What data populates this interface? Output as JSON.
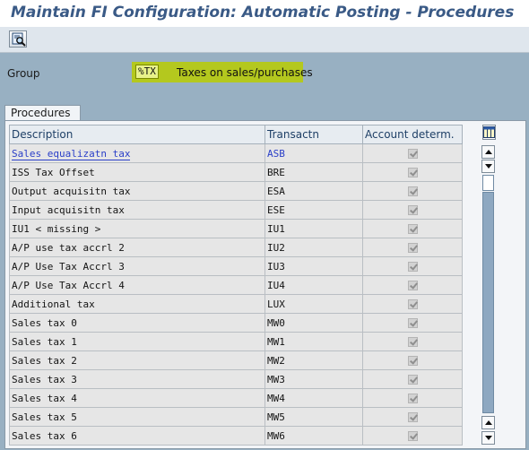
{
  "window": {
    "title": "Maintain FI Configuration: Automatic Posting - Procedures"
  },
  "toolbar": {
    "icon": "search-icon"
  },
  "group": {
    "label": "Group",
    "code": "%TX",
    "text": "Taxes on sales/purchases"
  },
  "tab": {
    "label": "Procedures"
  },
  "table": {
    "columns": [
      "Description",
      "Transactn",
      "Account determ."
    ],
    "rows": [
      {
        "description": "Sales equalizatn tax",
        "transaction": "ASB",
        "account_determ": true
      },
      {
        "description": "ISS Tax Offset",
        "transaction": "BRE",
        "account_determ": true
      },
      {
        "description": "Output acquisitn tax",
        "transaction": "ESA",
        "account_determ": true
      },
      {
        "description": "Input acquisitn tax",
        "transaction": "ESE",
        "account_determ": true
      },
      {
        "description": "IU1 < missing >",
        "transaction": "IU1",
        "account_determ": true
      },
      {
        "description": "A/P use tax accrl 2",
        "transaction": "IU2",
        "account_determ": true
      },
      {
        "description": "A/P Use Tax Accrl 3",
        "transaction": "IU3",
        "account_determ": true
      },
      {
        "description": "A/P Use Tax Accrl 4",
        "transaction": "IU4",
        "account_determ": true
      },
      {
        "description": "Additional tax",
        "transaction": "LUX",
        "account_determ": true
      },
      {
        "description": "Sales tax 0",
        "transaction": "MW0",
        "account_determ": true
      },
      {
        "description": "Sales tax 1",
        "transaction": "MW1",
        "account_determ": true
      },
      {
        "description": "Sales tax 2",
        "transaction": "MW2",
        "account_determ": true
      },
      {
        "description": "Sales tax 3",
        "transaction": "MW3",
        "account_determ": true
      },
      {
        "description": "Sales tax 4",
        "transaction": "MW4",
        "account_determ": true
      },
      {
        "description": "Sales tax 5",
        "transaction": "MW5",
        "account_determ": true
      },
      {
        "description": "Sales tax 6",
        "transaction": "MW6",
        "account_determ": true
      }
    ]
  },
  "colors": {
    "accent": "#b4c81e",
    "title": "#3a5a86",
    "selected_text": "#2a3fc8"
  }
}
